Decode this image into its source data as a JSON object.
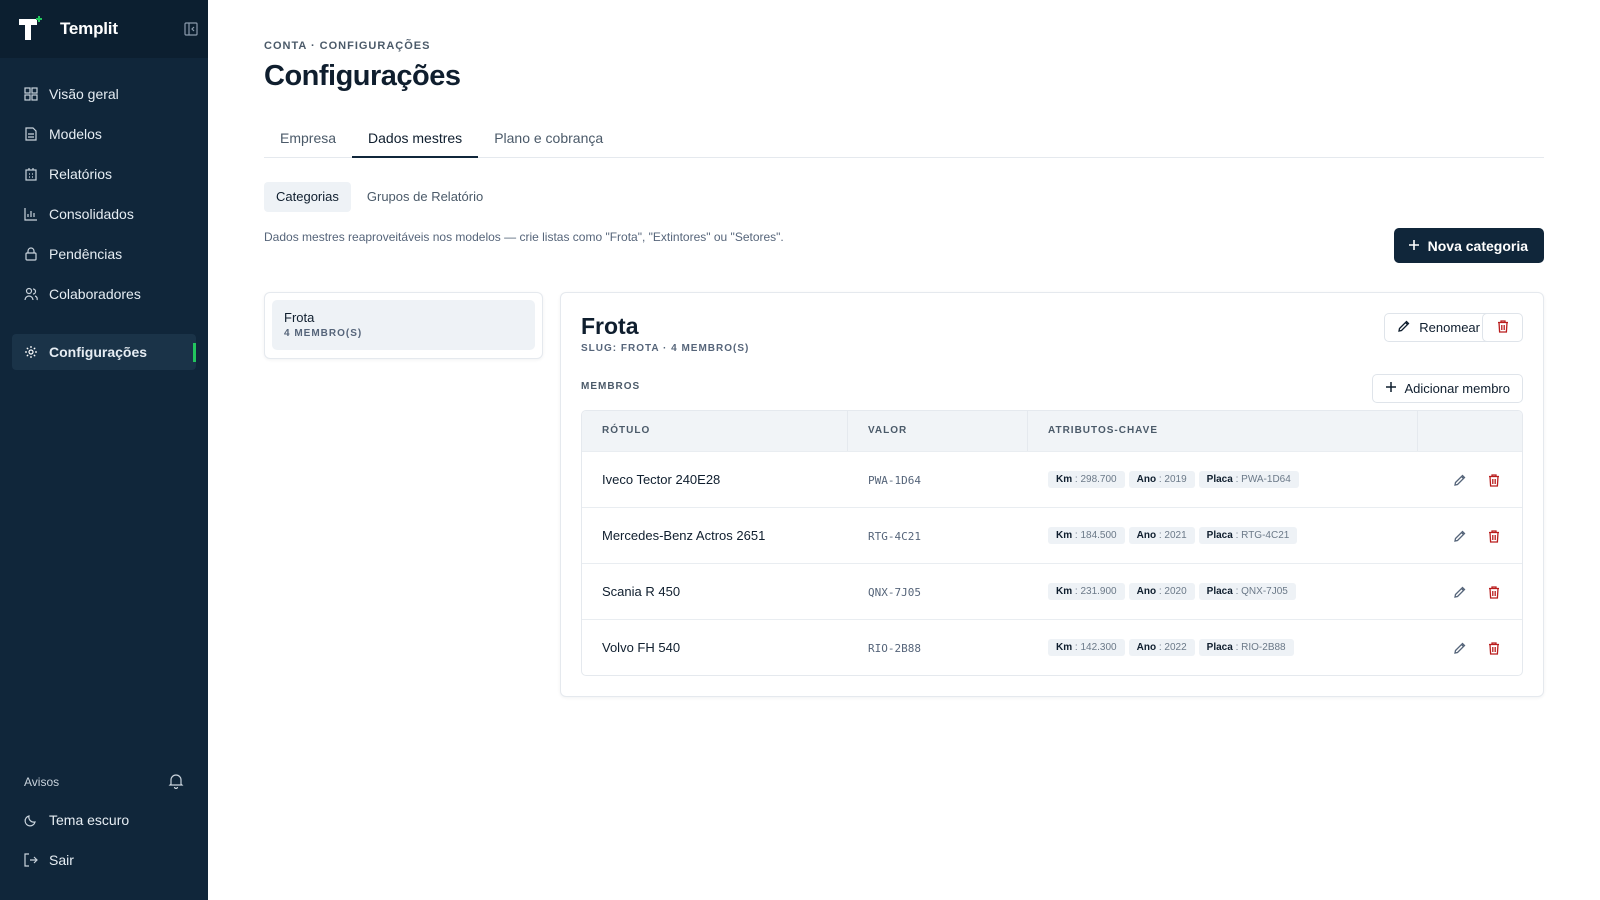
{
  "app": {
    "name": "Templit"
  },
  "sidebar": {
    "items": [
      {
        "label": "Visão geral",
        "icon": "grid-icon"
      },
      {
        "label": "Modelos",
        "icon": "document-icon"
      },
      {
        "label": "Relatórios",
        "icon": "building-icon"
      },
      {
        "label": "Consolidados",
        "icon": "bar-chart-icon"
      },
      {
        "label": "Pendências",
        "icon": "lock-icon"
      },
      {
        "label": "Colaboradores",
        "icon": "users-icon"
      }
    ],
    "active_item": {
      "label": "Configurações",
      "icon": "gear-icon"
    },
    "avisos_label": "Avisos",
    "theme_label": "Tema escuro",
    "logout_label": "Sair",
    "accent_color": "#22c55e"
  },
  "page": {
    "breadcrumb": "CONTA · CONFIGURAÇÕES",
    "title": "Configurações",
    "tabs": [
      "Empresa",
      "Dados mestres",
      "Plano e cobrança"
    ],
    "active_tab": "Dados mestres",
    "subtabs": [
      "Categorias",
      "Grupos de Relatório"
    ],
    "active_subtab": "Categorias",
    "description": "Dados mestres reaproveitáveis nos modelos — crie listas como \"Frota\", \"Extintores\" ou \"Setores\".",
    "new_category_label": "Nova categoria"
  },
  "categories": [
    {
      "name": "Frota",
      "count_label": "4 MEMBRO(S)"
    }
  ],
  "detail": {
    "title": "Frota",
    "slug_line": "SLUG: FROTA · 4 MEMBRO(S)",
    "rename_label": "Renomear",
    "members_label": "MEMBROS",
    "add_member_label": "Adicionar membro",
    "columns": [
      "RÓTULO",
      "VALOR",
      "ATRIBUTOS-CHAVE",
      ""
    ],
    "rows": [
      {
        "label": "Iveco Tector 240E28",
        "value": "PWA-1D64",
        "attrs": [
          {
            "k": "Km",
            "v": ": 298.700"
          },
          {
            "k": "Ano",
            "v": ": 2019"
          },
          {
            "k": "Placa",
            "v": ": PWA-1D64"
          }
        ]
      },
      {
        "label": "Mercedes-Benz Actros 2651",
        "value": "RTG-4C21",
        "attrs": [
          {
            "k": "Km",
            "v": ": 184.500"
          },
          {
            "k": "Ano",
            "v": ": 2021"
          },
          {
            "k": "Placa",
            "v": ": RTG-4C21"
          }
        ]
      },
      {
        "label": "Scania R 450",
        "value": "QNX-7J05",
        "attrs": [
          {
            "k": "Km",
            "v": ": 231.900"
          },
          {
            "k": "Ano",
            "v": ": 2020"
          },
          {
            "k": "Placa",
            "v": ": QNX-7J05"
          }
        ]
      },
      {
        "label": "Volvo FH 540",
        "value": "RIO-2B88",
        "attrs": [
          {
            "k": "Km",
            "v": ": 142.300"
          },
          {
            "k": "Ano",
            "v": ": 2022"
          },
          {
            "k": "Placa",
            "v": ": RIO-2B88"
          }
        ]
      }
    ]
  },
  "colors": {
    "sidebar_bg": "#10263a",
    "primary": "#10263a",
    "danger": "#b91c1c"
  }
}
